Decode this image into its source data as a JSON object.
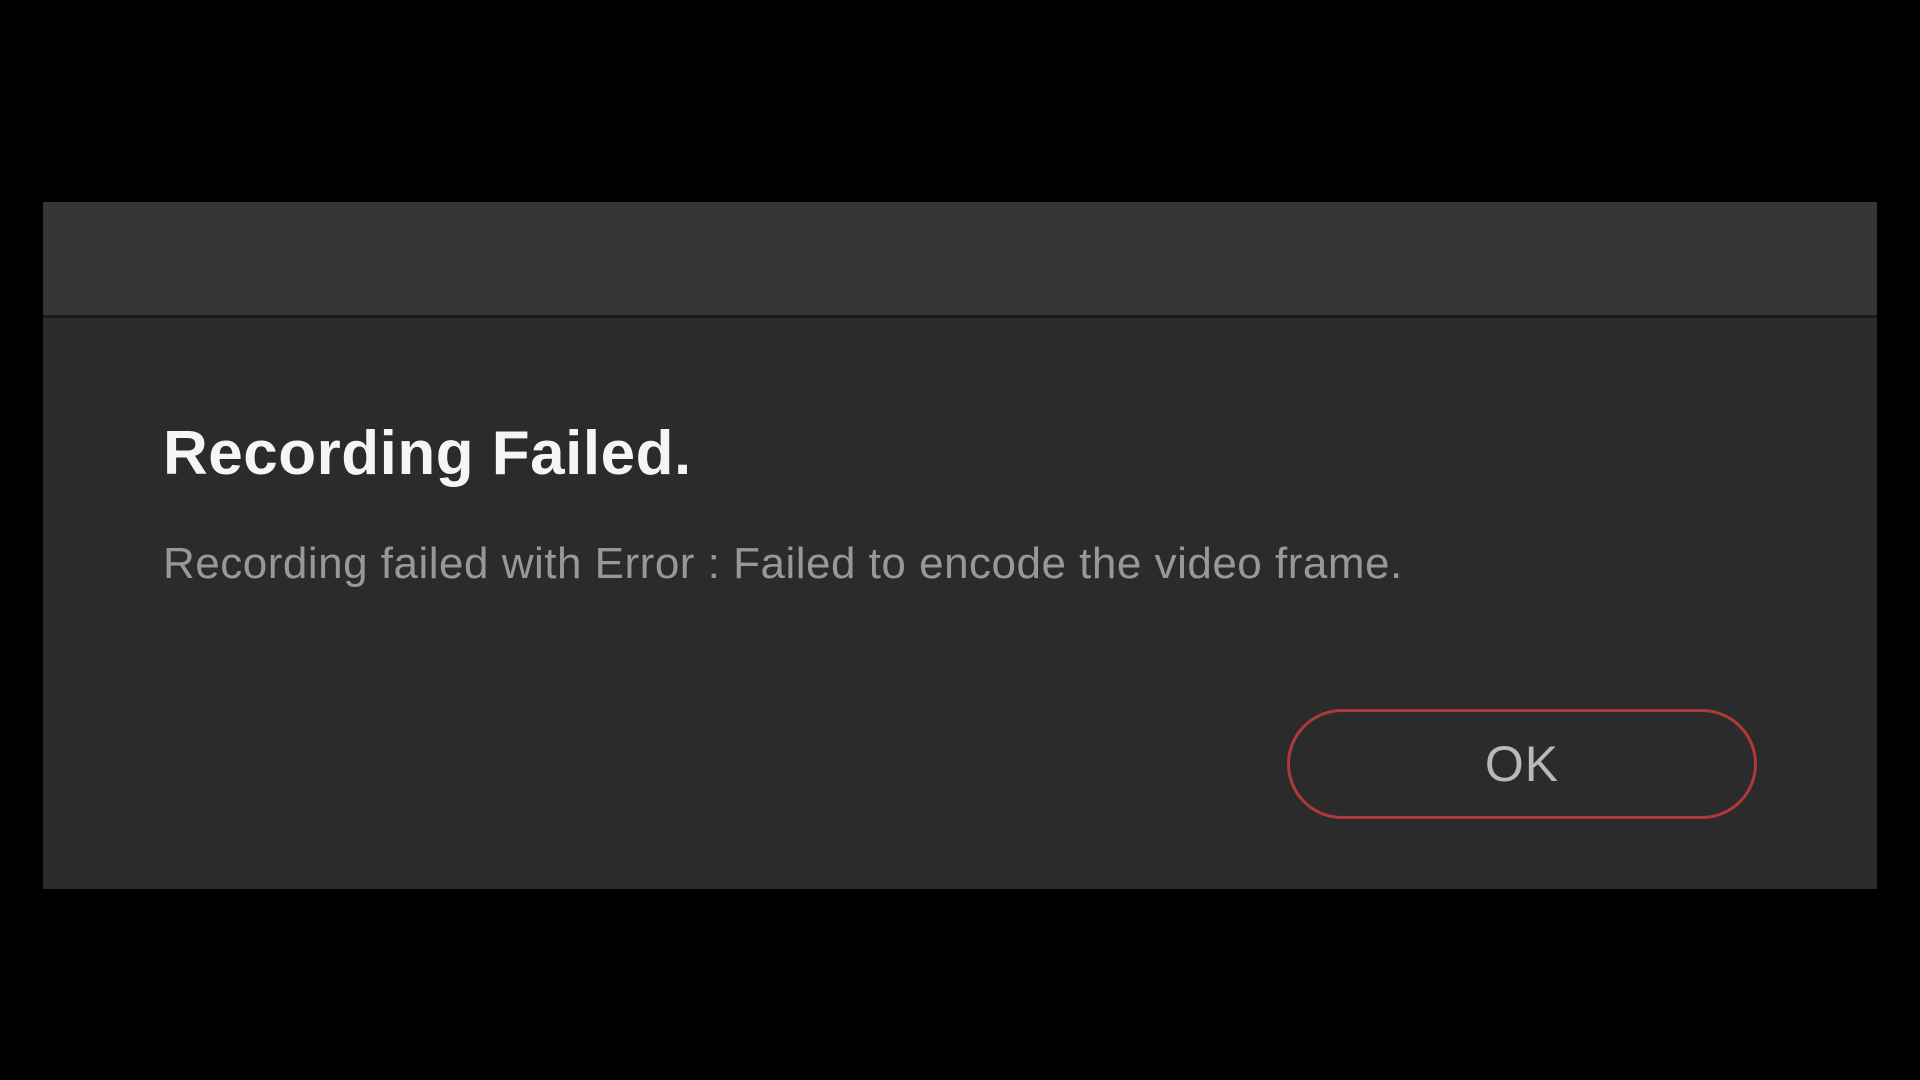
{
  "dialog": {
    "heading": "Recording Failed.",
    "message": "Recording failed with Error : Failed to encode the video frame.",
    "ok_label": "OK"
  }
}
